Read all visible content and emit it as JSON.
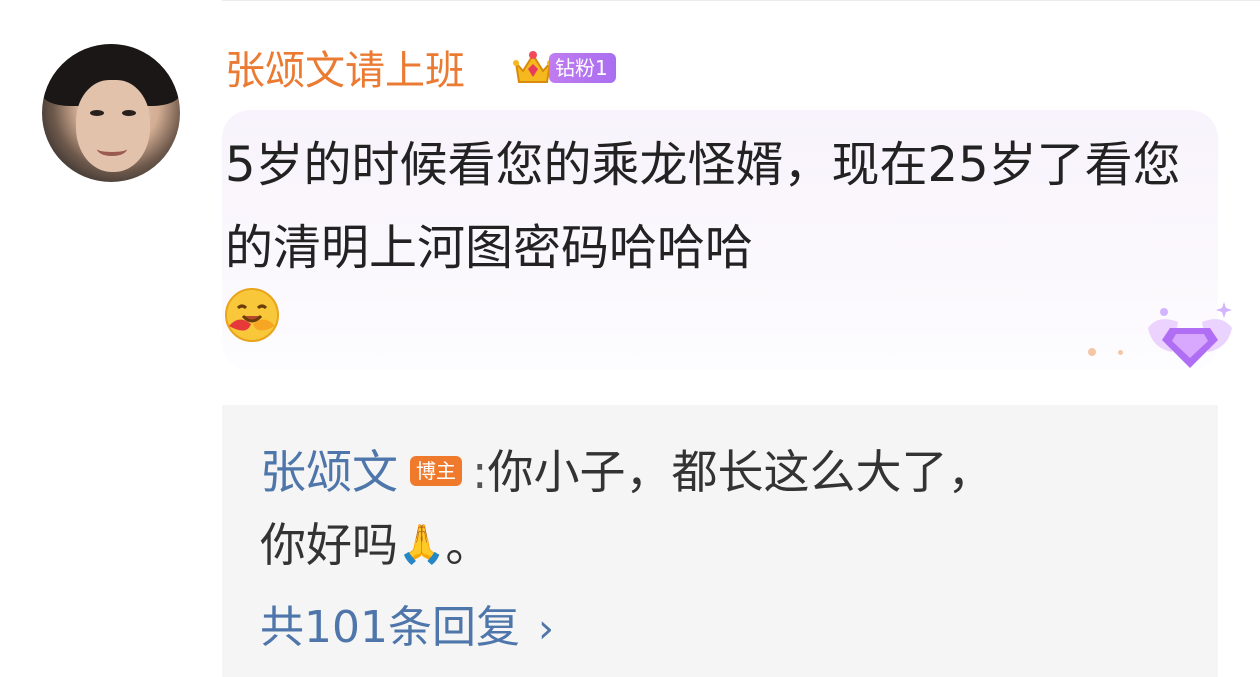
{
  "comment": {
    "username": "张颂文请上班",
    "fan_badge": "钻粉1",
    "text": "5岁的时候看您的乘龙怪婿，现在25岁了看您的清明上河图密码哈哈哈",
    "emoji": "hug-face-icon",
    "decoration": "diamond-wings-icon"
  },
  "reply": {
    "author": "张颂文",
    "author_badge": "博主",
    "separator": ":",
    "text_line1": "你小子，都长这么大了，",
    "text_line2_a": "你好吗",
    "text_line2_b": "。",
    "emoji": "folded-hands-icon",
    "more_link": "共101条回复",
    "chevron": "›"
  },
  "colors": {
    "username": "#eb7a33",
    "fan_badge": "#b276f0",
    "reply_author": "#4e76ab",
    "owner_badge": "#f07a2c",
    "bubble_bg": "#f8f3fc",
    "reply_bg": "#f5f5f5"
  }
}
